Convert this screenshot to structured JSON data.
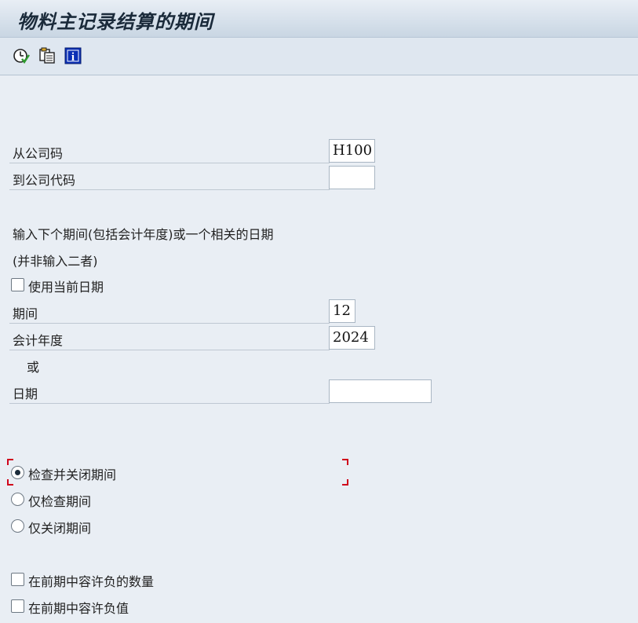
{
  "window": {
    "title": "物料主记录结算的期间"
  },
  "toolbar": {
    "buttons": [
      {
        "icon": "execute-clock-icon"
      },
      {
        "icon": "variant-icon"
      },
      {
        "icon": "info-icon",
        "text": "i"
      }
    ]
  },
  "form": {
    "from_company": {
      "label": "从公司码",
      "value": "H100"
    },
    "to_company": {
      "label": "到公司代码",
      "value": ""
    },
    "instruction_1": "输入下个期间(包括会计年度)或一个相关的日期",
    "instruction_2": "(并非输入二者)",
    "use_current_date": {
      "label": "使用当前日期",
      "checked": false
    },
    "period": {
      "label": "期间",
      "value": "12"
    },
    "fiscal_year": {
      "label": "会计年度",
      "value": "2024"
    },
    "or_label": "或",
    "date": {
      "label": "日期",
      "value": ""
    }
  },
  "options": {
    "radios": [
      {
        "label": "检查并关闭期间",
        "selected": true
      },
      {
        "label": "仅检查期间",
        "selected": false
      },
      {
        "label": "仅关闭期间",
        "selected": false
      }
    ],
    "checkboxes": [
      {
        "label": "在前期中容许负的数量",
        "checked": false
      },
      {
        "label": "在前期中容许负值",
        "checked": false
      }
    ]
  },
  "colors": {
    "focus_marker": "#d0021b",
    "background": "#e9eef4"
  }
}
